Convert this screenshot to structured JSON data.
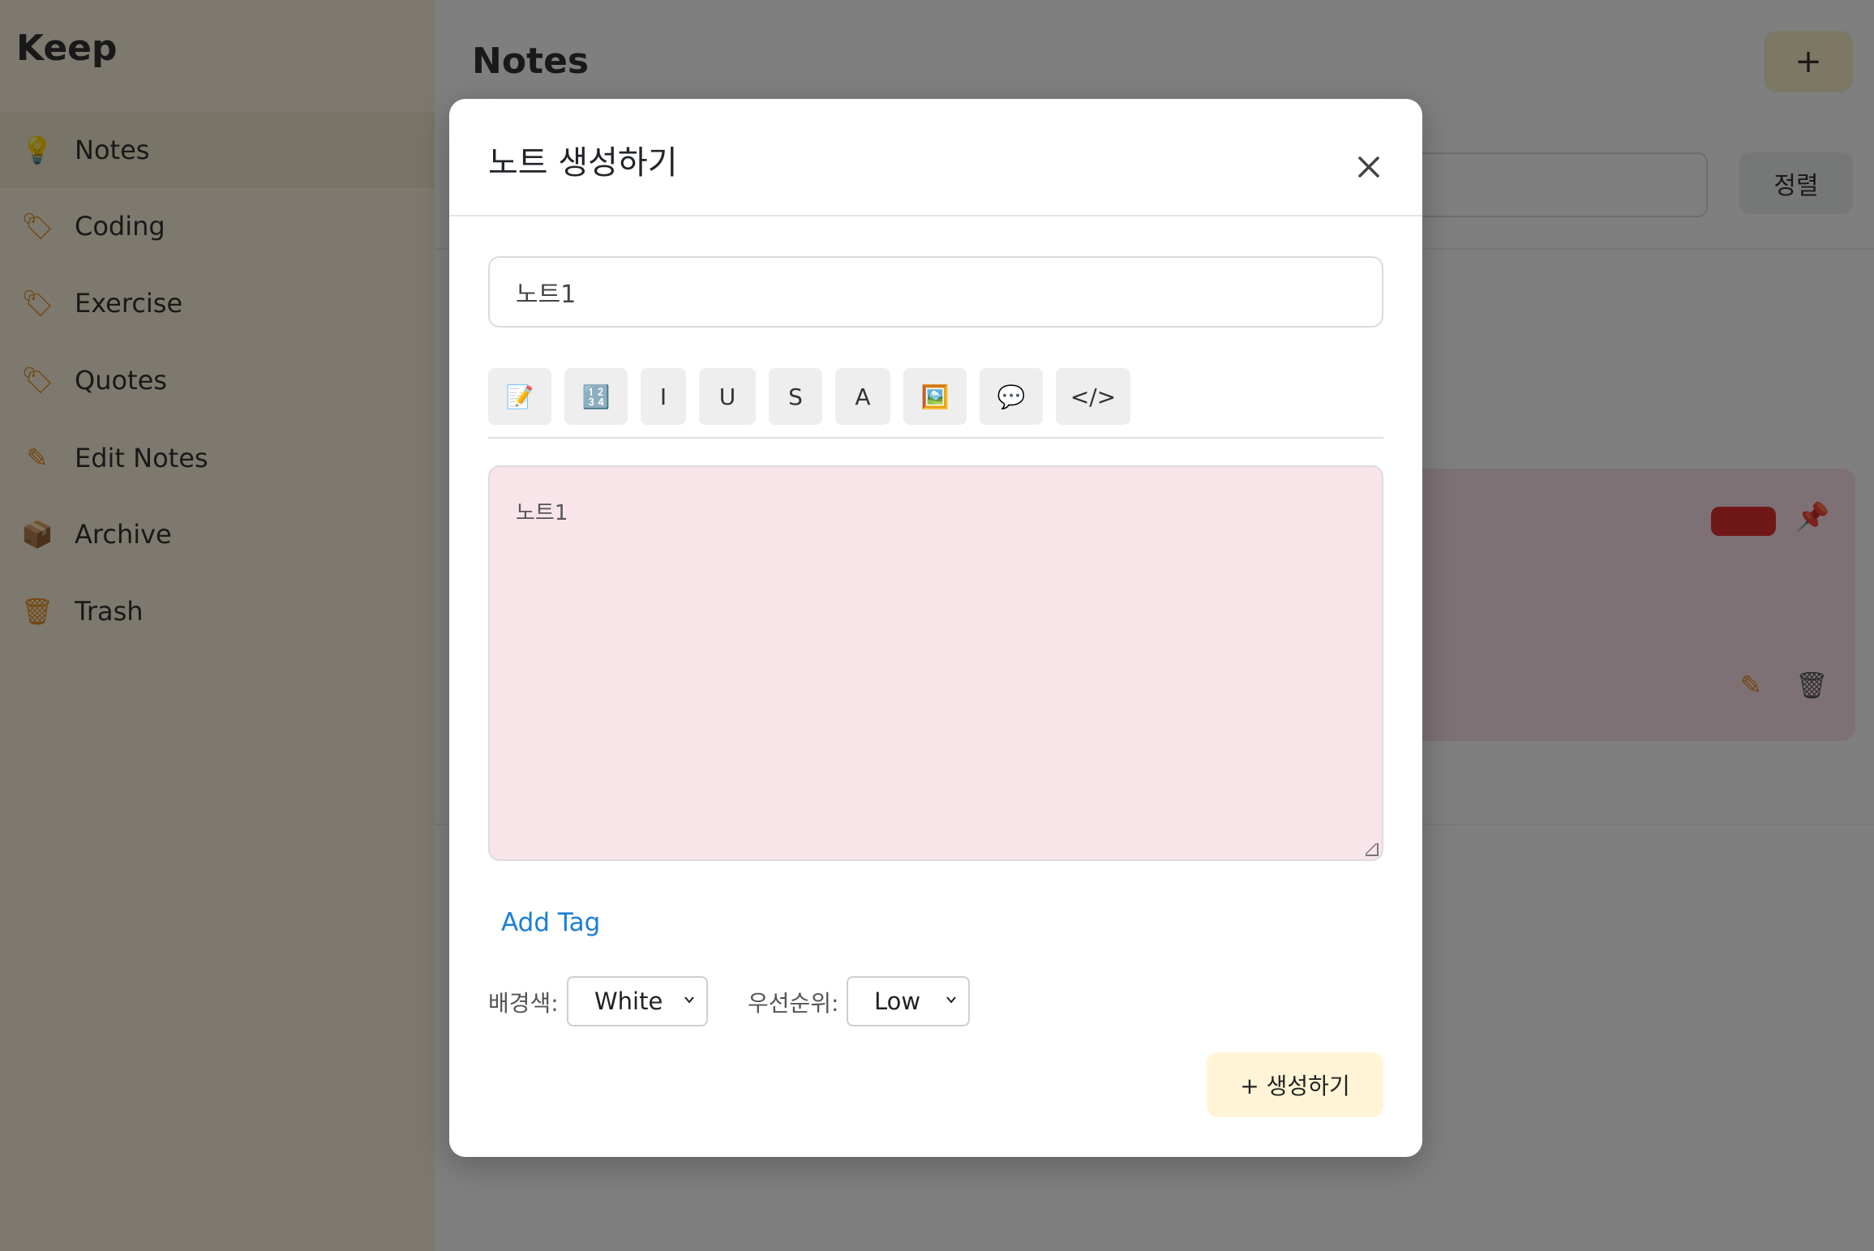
{
  "background_app": {
    "logo": "Keep",
    "sidebar": {
      "items": [
        {
          "label": "Notes",
          "icon": "lightbulb-icon",
          "active": true
        },
        {
          "label": "Coding",
          "icon": "label-icon"
        },
        {
          "label": "Exercise",
          "icon": "label-icon"
        },
        {
          "label": "Quotes",
          "icon": "label-icon"
        },
        {
          "label": "Edit Notes",
          "icon": "pencil-icon"
        },
        {
          "label": "Archive",
          "icon": "archive-icon"
        },
        {
          "label": "Trash",
          "icon": "trash-icon"
        }
      ]
    },
    "main": {
      "title": "Notes",
      "add_button": "+",
      "search_button": "정렬"
    }
  },
  "modal": {
    "title": "노트 생성하기",
    "close_label": "×",
    "title_input": {
      "value": "노트1"
    },
    "toolbar": [
      {
        "name": "memo-emoji-button",
        "label": "📝"
      },
      {
        "name": "numbers-emoji-button",
        "label": "🔢"
      },
      {
        "name": "italic-button",
        "label": "I"
      },
      {
        "name": "underline-button",
        "label": "U"
      },
      {
        "name": "strike-button",
        "label": "S"
      },
      {
        "name": "font-button",
        "label": "A"
      },
      {
        "name": "image-emoji-button",
        "label": "🖼️"
      },
      {
        "name": "comment-emoji-button",
        "label": "💬"
      },
      {
        "name": "code-button",
        "label": "</>"
      }
    ],
    "content": {
      "value": "노트1"
    },
    "add_tag": "Add Tag",
    "background_color": {
      "label": "배경색:",
      "selected": "White"
    },
    "priority": {
      "label": "우선순위:",
      "selected": "Low"
    },
    "create_button": "+ 생성하기"
  },
  "colors": {
    "content_bg": "#f9e4ea",
    "create_button_bg": "#fff4d6",
    "link": "#1c7ed6"
  }
}
